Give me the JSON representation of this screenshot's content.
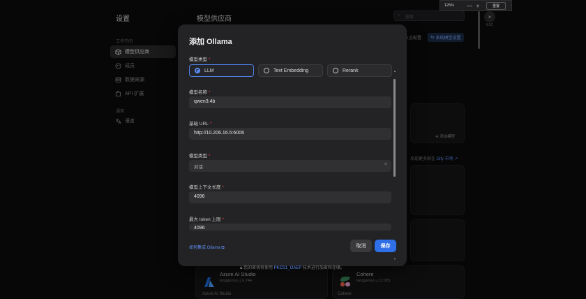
{
  "zoom": {
    "value": "125%",
    "minus": "—",
    "plus": "+",
    "reset_label": "重置"
  },
  "nav": {
    "title": "设置",
    "group_workspace": "工作空间",
    "items": [
      {
        "label": "模型供应商",
        "icon": "cube-icon"
      },
      {
        "label": "成员",
        "icon": "members-icon"
      },
      {
        "label": "数据来源",
        "icon": "database-icon"
      },
      {
        "label": "API 扩展",
        "icon": "puzzle-icon"
      }
    ],
    "group_general": "通用",
    "language_label": "语言"
  },
  "main": {
    "title": "模型供应商",
    "search_placeholder": "搜索",
    "default_config_link": "认全配置",
    "system_model_button": "系统模型设置",
    "add_model": "添加模型",
    "dify_link_prefix": "发现更多就在",
    "dify_link": "Dify 市场",
    "providers": [
      {
        "name": "Azure AI Studio",
        "author": "langgenius",
        "downloads": "6,744",
        "footer": "Azure AI Studio"
      },
      {
        "name": "Cohere",
        "author": "langgenius",
        "downloads": "12,981",
        "footer": "Cohere"
      }
    ]
  },
  "close": {
    "icon": "×",
    "hint": "ESC"
  },
  "modal": {
    "title": "添加 Ollama",
    "model_type_label": "模型类型",
    "model_types": [
      {
        "label": "LLM",
        "selected": true
      },
      {
        "label": "Text Embedding",
        "selected": false
      },
      {
        "label": "Rerank",
        "selected": false
      }
    ],
    "model_name_label": "模型名称",
    "model_name_value": "qwen3:4b",
    "base_url_label": "基础 URL",
    "base_url_value": "http://10.206.16.5:6006",
    "model_category_label": "模型类型",
    "model_category_value": "对话",
    "context_length_label": "模型上下文长度",
    "context_length_value": "4096",
    "max_token_label": "最大 token 上限",
    "max_token_value": "4096",
    "help_link": "如何集成 Ollama",
    "cancel_label": "取消",
    "save_label": "保存",
    "required_mark": "*"
  },
  "encryption_notice": {
    "prefix": "您的密钥将使用",
    "highlight": "PKCS1_OAEP",
    "suffix": "技术进行加密和存储。"
  }
}
